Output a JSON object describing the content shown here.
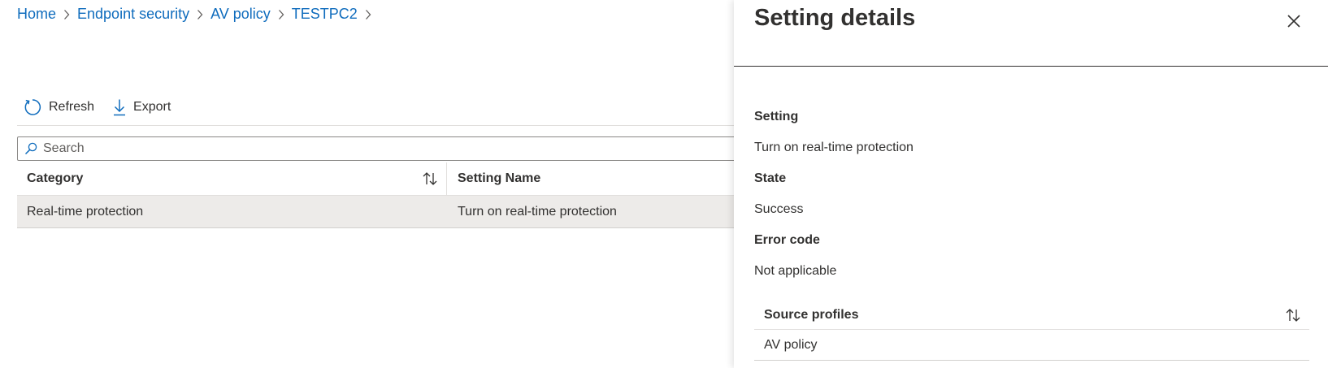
{
  "breadcrumb": {
    "items": [
      "Home",
      "Endpoint security",
      "AV policy",
      "TESTPC2"
    ]
  },
  "toolbar": {
    "refresh_label": "Refresh",
    "export_label": "Export"
  },
  "search": {
    "placeholder": "Search",
    "value": ""
  },
  "grid": {
    "columns": [
      "Category",
      "Setting Name"
    ],
    "rows": [
      {
        "category": "Real-time protection",
        "setting_name": "Turn on real-time protection"
      }
    ]
  },
  "panel": {
    "title": "Setting details",
    "setting_label": "Setting",
    "setting_value": "Turn on real-time protection",
    "state_label": "State",
    "state_value": "Success",
    "error_label": "Error code",
    "error_value": "Not applicable",
    "source_profiles_header": "Source profiles",
    "source_profiles": [
      "AV policy"
    ]
  },
  "colors": {
    "link": "#0f6cbd",
    "text": "#323130",
    "row_selected": "#edebe9"
  },
  "icons": {
    "refresh": "refresh-icon",
    "export": "download-icon",
    "search": "search-icon",
    "sort": "sort-icon",
    "close": "close-icon",
    "breadcrumb_separator": "chevron-right-icon"
  }
}
